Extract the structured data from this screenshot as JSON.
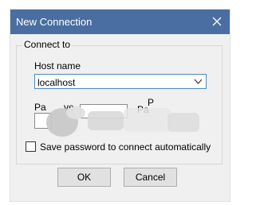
{
  "window": {
    "title": "New Connection",
    "close_icon": "close-icon"
  },
  "group": {
    "label": "Connect to"
  },
  "host": {
    "label": "Host name",
    "value": "localhost",
    "dropdown_icon": "chevron-down-icon"
  },
  "partial": {
    "left_fragment": "Pa",
    "left_fragment2": "ve",
    "right_fragment": "P",
    "right_fragment2": "Pa"
  },
  "save_password": {
    "label": "Save password to connect automatically",
    "checked": false
  },
  "buttons": {
    "ok": "OK",
    "cancel": "Cancel"
  },
  "colors": {
    "titlebar": "#4a6ea1",
    "dialog": "#f0f0f0",
    "focus_border": "#4a89c9"
  }
}
